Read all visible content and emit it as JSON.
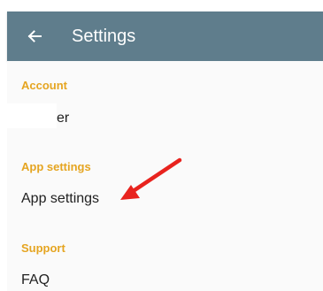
{
  "header": {
    "title": "Settings",
    "back_icon": "arrow-left-icon"
  },
  "colors": {
    "appbar": "#5f7d8c",
    "section_header": "#e5a521",
    "annotation_arrow": "#e8231e"
  },
  "sections": {
    "account": {
      "header": "Account",
      "item_label": "/ Olivier"
    },
    "app_settings": {
      "header": "App settings",
      "item_label": "App settings"
    },
    "support": {
      "header": "Support",
      "item_label": "FAQ"
    }
  }
}
